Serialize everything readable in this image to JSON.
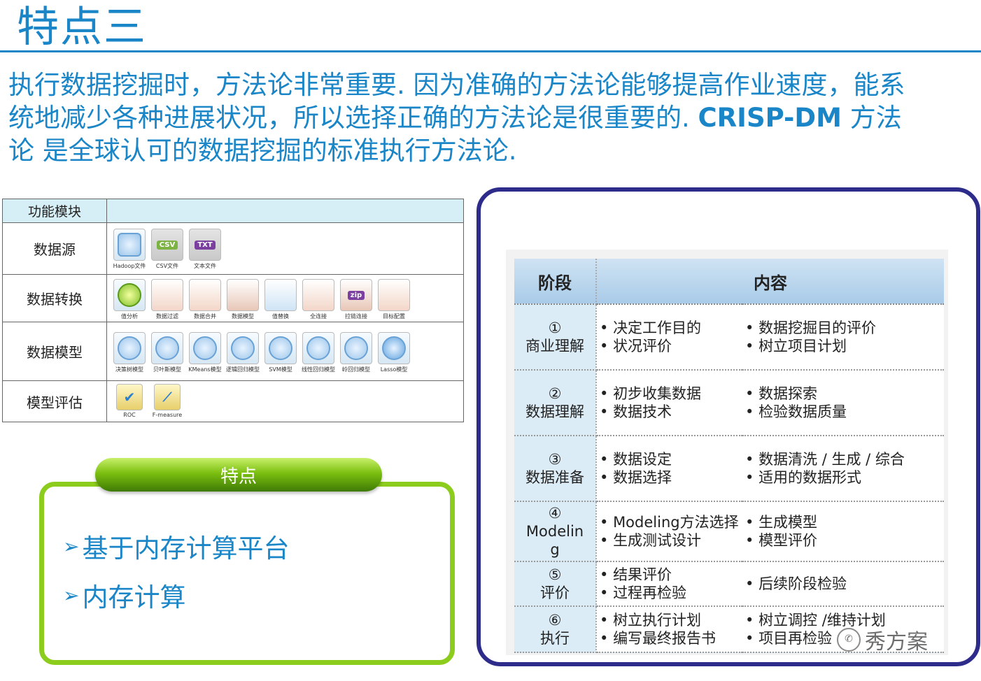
{
  "title": "特点三",
  "intro": {
    "line1": "执行数据挖掘时，方法论非常重要. 因为准确的方法论能够提高作业速度，能系",
    "line2_a": "统地减少各种进展状况，所以选择正确的方法论是很重要的.",
    "line2_b": "CRISP-DM",
    "line2_c": "方法",
    "line3": "论 是全球认可的数据挖掘的标准执行方法论."
  },
  "modules": {
    "header": "功能模块",
    "rows": [
      {
        "label": "数据源",
        "icons": [
          "Hadoop文件",
          "CSV文件",
          "文本文件"
        ]
      },
      {
        "label": "数据转换",
        "icons": [
          "值分析",
          "数据过滤",
          "数据合并",
          "数据模型",
          "值替换",
          "全连接",
          "拉链连接",
          "目标配置"
        ]
      },
      {
        "label": "数据模型",
        "icons": [
          "决策树模型",
          "贝叶斯模型",
          "KMeans模型",
          "逻辑回归模型",
          "SVM模型",
          "线性回归模型",
          "岭回归模型",
          "Lasso模型"
        ]
      },
      {
        "label": "模型评估",
        "icons": [
          "ROC",
          "F-measure"
        ]
      }
    ],
    "badges": {
      "csv": "CSV",
      "txt": "TXT",
      "zip": "zip"
    }
  },
  "feature": {
    "pill": "特点",
    "items": [
      "基于内存计算平台",
      "内存计算"
    ]
  },
  "stages": {
    "headers": [
      "阶段",
      "内容"
    ],
    "rows": [
      {
        "num": "①",
        "name": "商业理解",
        "c1": [
          "决定工作目的",
          "状况评价"
        ],
        "c2": [
          "数据挖掘目的评价",
          "树立项目计划"
        ]
      },
      {
        "num": "②",
        "name": "数据理解",
        "c1": [
          "初步收集数据",
          "数据技术"
        ],
        "c2": [
          "数据探索",
          "检验数据质量"
        ]
      },
      {
        "num": "③",
        "name": "数据准备",
        "c1": [
          "数据设定",
          "数据选择"
        ],
        "c2": [
          "数据清洗 / 生成 / 综合",
          "适用的数据形式"
        ]
      },
      {
        "num": "④",
        "name": "Modelin\ng",
        "c1": [
          "Modeling方法选择",
          "生成测试设计"
        ],
        "c2": [
          "生成模型",
          "模型评价"
        ]
      },
      {
        "num": "⑤",
        "name": "评价",
        "c1": [
          "结果评价",
          "过程再检验"
        ],
        "c2": [
          "后续阶段检验"
        ]
      },
      {
        "num": "⑥",
        "name": "执行",
        "c1": [
          "树立执行计划",
          "编写最终报告书"
        ],
        "c2": [
          "树立调控 /维持计划",
          "项目再检验"
        ]
      }
    ]
  },
  "watermark": "秀方案",
  "colors": {
    "accent": "#1a86c8",
    "green": "#8ccc1c",
    "navy": "#2e2c8a"
  }
}
